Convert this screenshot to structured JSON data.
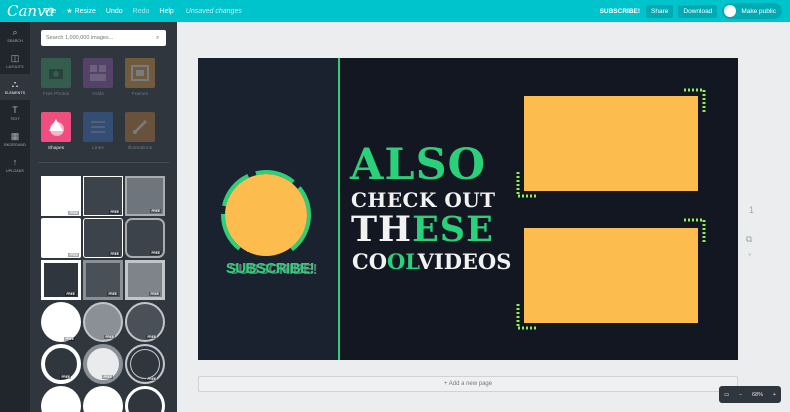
{
  "app": {
    "logo": "Canva",
    "menu": [
      "File",
      "Resize",
      "Undo",
      "Redo",
      "Help"
    ],
    "status": "Unsaved changes",
    "subscribe": "SUBSCRIBE!",
    "share": "Share",
    "download": "Download",
    "make_public": "Make public"
  },
  "rail": [
    {
      "label": "SEARCH",
      "icon": "search-icon"
    },
    {
      "label": "LAYOUTS",
      "icon": "layouts-icon"
    },
    {
      "label": "ELEMENTS",
      "icon": "elements-icon"
    },
    {
      "label": "TEXT",
      "icon": "text-icon"
    },
    {
      "label": "BKGROUND",
      "icon": "background-icon"
    },
    {
      "label": "UPLOADS",
      "icon": "uploads-icon"
    }
  ],
  "panel": {
    "search_placeholder": "Search 1,000,000 images...",
    "categories": [
      {
        "label": "Free Photos"
      },
      {
        "label": "Grids"
      },
      {
        "label": "Frames"
      },
      {
        "label": "Shapes"
      },
      {
        "label": "Lines"
      },
      {
        "label": "Illustrations"
      }
    ],
    "free_badge": "FREE"
  },
  "canvas": {
    "subscribe_text": "SUBSCRIBE!",
    "subscribe_ghost": "SUBSCRIBE!",
    "also": "ALSO",
    "check_out": "CHECK OUT",
    "these_a": "TH",
    "these_b": "ESE",
    "cool_a": "CO",
    "cool_b": "OL",
    "cool_c": "VIDEOS"
  },
  "colors": {
    "accent": "#00c4cc",
    "green": "#2bd07a",
    "orange": "#fdbd4e",
    "canvas_bg": "#131722"
  },
  "workspace": {
    "page_number": "1",
    "add_page": "+ Add a new page",
    "zoom_level": "68%"
  }
}
